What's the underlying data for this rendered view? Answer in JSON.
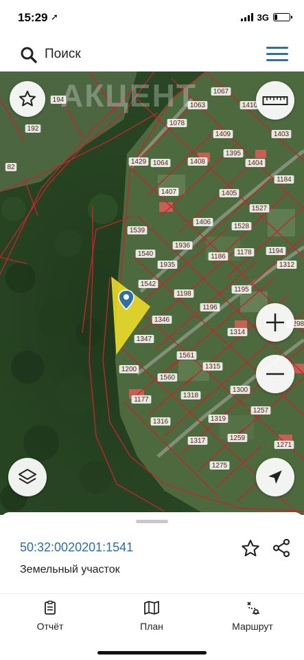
{
  "status_bar": {
    "time": "15:29",
    "location_glyph": "➚",
    "network": "3G",
    "signal_bars": 4,
    "battery_level": 0.2
  },
  "search": {
    "placeholder": "Поиск",
    "icon": "search-icon",
    "menu_icon": "hamburger-menu-icon"
  },
  "map": {
    "watermark": "АКЦЕНТ",
    "accent_color": "#c0262d",
    "selected_parcel_color": "#f4e32a",
    "marker_color": "#2f6fa3",
    "parcel_labels": [
      "194",
      "1067",
      "1063",
      "1410",
      "192",
      "1078",
      "1409",
      "1403",
      "82",
      "1429",
      "1064",
      "1408",
      "1395",
      "1404",
      "1184",
      "1407",
      "1405",
      "1527",
      "1406",
      "1528",
      "1539",
      "1936",
      "1540",
      "1935",
      "1186",
      "1178",
      "1194",
      "1542",
      "1198",
      "1195",
      "1312",
      "1346",
      "1196",
      "1314",
      "1298",
      "1347",
      "1561",
      "1315",
      "1200",
      "1560",
      "1318",
      "1300",
      "1177",
      "1257",
      "1319",
      "1316",
      "1317",
      "1259",
      "1271",
      "1275"
    ],
    "buttons": {
      "favorite": "star-icon",
      "ruler": "ruler-icon",
      "zoom_in": "plus-icon",
      "zoom_out": "minus-icon",
      "locate": "navigation-arrow-icon",
      "layers": "layers-icon"
    }
  },
  "sheet": {
    "cadastral_number": "50:32:0020201:1541",
    "parcel_type": "Земельный участок"
  },
  "tabs": [
    {
      "label": "Отчёт",
      "icon": "report-icon"
    },
    {
      "label": "План",
      "icon": "map-icon"
    },
    {
      "label": "Маршрут",
      "icon": "route-icon"
    }
  ]
}
